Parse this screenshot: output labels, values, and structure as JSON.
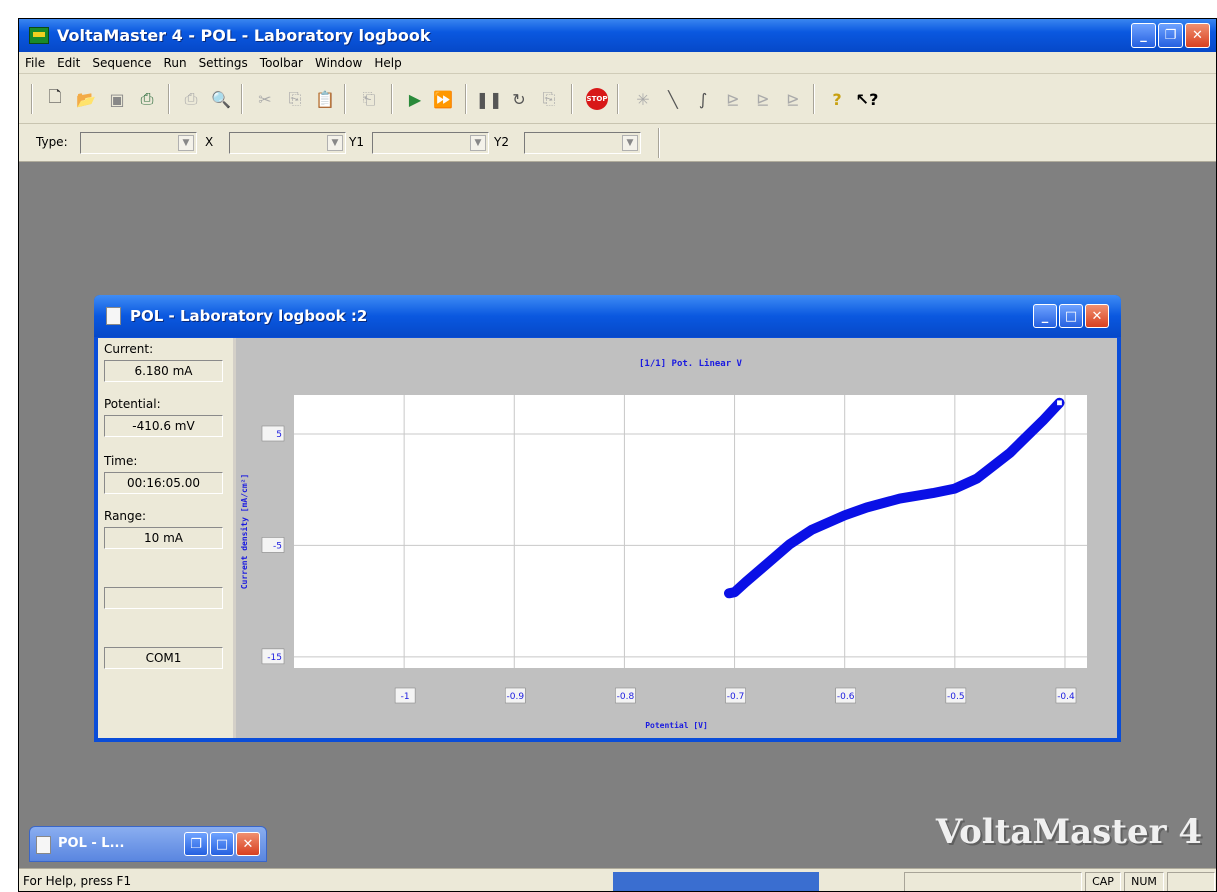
{
  "app": {
    "title": "VoltaMaster 4 - POL - Laboratory logbook",
    "watermark": "VoltaMaster 4"
  },
  "window_buttons": {
    "minimize": "_",
    "restore": "❐",
    "maximize": "□",
    "close": "✕"
  },
  "menu": [
    "File",
    "Edit",
    "Sequence",
    "Run",
    "Settings",
    "Toolbar",
    "Window",
    "Help"
  ],
  "toolbar_icons": [
    "new-icon",
    "open-icon",
    "save-icon",
    "print-icon",
    "print-setup-icon",
    "preview-icon",
    "cut-icon",
    "copy-icon",
    "paste-icon",
    "export-icon",
    "run-icon",
    "run-all-icon",
    "pause-icon",
    "rewind-icon",
    "copy-results-icon",
    "stop-icon",
    "cursor-icon",
    "line-icon",
    "slope-icon",
    "fit1-icon",
    "fit2-icon",
    "fit3-icon",
    "help-icon",
    "context-help-icon"
  ],
  "toolbar2": {
    "type_label": "Type:",
    "x_label": "X",
    "y1_label": "Y1",
    "y2_label": "Y2"
  },
  "child": {
    "title": "POL - Laboratory logbook :2",
    "current_label": "Current:",
    "current_value": "6.180 mA",
    "potential_label": "Potential:",
    "potential_value": "-410.6 mV",
    "time_label": "Time:",
    "time_value": "00:16:05.00",
    "range_label": "Range:",
    "range_value": "10 mA",
    "blank_value": "",
    "port_value": "COM1"
  },
  "minimized": {
    "title": "POL - L..."
  },
  "statusbar": {
    "help": "For Help, press F1",
    "cap": "CAP",
    "num": "NUM"
  },
  "chart_data": {
    "type": "line",
    "title": "[1/1] Pot. Linear V",
    "xlabel": "Potential [V]",
    "ylabel": "Current density [mA/cm²]",
    "xlim": [
      -1.1,
      -0.38
    ],
    "ylim": [
      -16,
      8.5
    ],
    "xticks": [
      -1,
      -0.9,
      -0.8,
      -0.7,
      -0.6,
      -0.5,
      -0.4
    ],
    "xtick_labels": [
      "-1",
      "-0.9",
      "-0.8",
      "-0.7",
      "-0.6",
      "-0.5",
      "-0.4"
    ],
    "yticks": [
      5,
      -5,
      -15
    ],
    "ytick_labels": [
      "5",
      "-5",
      "-15"
    ],
    "grid": true,
    "series": [
      {
        "color": "#0a10e6",
        "x": [
          -0.705,
          -0.7,
          -0.69,
          -0.67,
          -0.65,
          -0.63,
          -0.6,
          -0.58,
          -0.55,
          -0.52,
          -0.5,
          -0.48,
          -0.45,
          -0.42,
          -0.405
        ],
        "y": [
          -9.3,
          -9.2,
          -8.3,
          -6.6,
          -4.9,
          -3.6,
          -2.3,
          -1.6,
          -0.8,
          -0.3,
          0.1,
          1.0,
          3.3,
          6.2,
          7.8
        ]
      }
    ]
  },
  "colors": {
    "title_bar": "#0a58e0",
    "curve": "#0a10e6",
    "desktop": "#808080"
  }
}
